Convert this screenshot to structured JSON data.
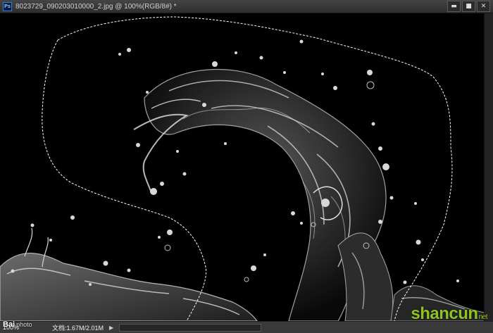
{
  "window": {
    "title": "8023729_090203010000_2.jpg @ 100%(RGB/8#) *",
    "app_icon": "Ps",
    "minimize": "▬",
    "maximize": "■",
    "close": "✕"
  },
  "canvas": {
    "image_subject": "water splash on black background",
    "selection": "marching-ants lasso"
  },
  "statusbar": {
    "zoom": "100%",
    "doc_info": "文档:1.67M/2.01M",
    "arrow": "▶"
  },
  "watermarks": {
    "left_brand": "Bai",
    "left_site": "photo",
    "right_logo": "shancun",
    "right_logo_suffix": "net"
  },
  "colors": {
    "accent_ps": "#2f7fd0",
    "logo_green": "#8fc31f"
  }
}
